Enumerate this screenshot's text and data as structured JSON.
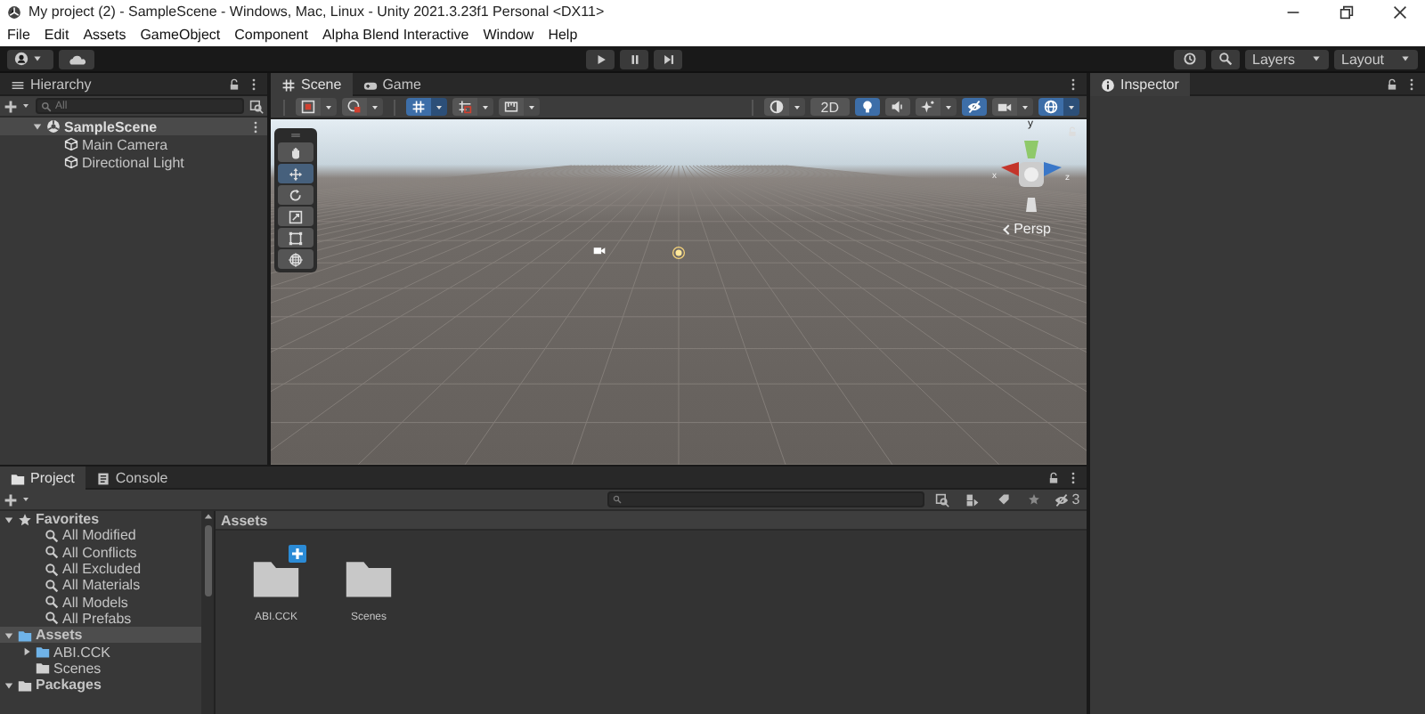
{
  "window": {
    "title": "My project (2) - SampleScene - Windows, Mac, Linux - Unity 2021.3.23f1 Personal <DX11>"
  },
  "menu": [
    "File",
    "Edit",
    "Assets",
    "GameObject",
    "Component",
    "Alpha Blend Interactive",
    "Window",
    "Help"
  ],
  "toolbar": {
    "layers": "Layers",
    "layout": "Layout"
  },
  "hierarchy": {
    "title": "Hierarchy",
    "search_placeholder": "All",
    "tree": [
      {
        "label": "SampleScene",
        "expanded": true,
        "selected": true,
        "children": [
          {
            "label": "Main Camera",
            "selected": false
          },
          {
            "label": "Directional Light",
            "selected": false
          }
        ]
      }
    ]
  },
  "scene": {
    "tabs": [
      {
        "label": "Scene",
        "selected": true
      },
      {
        "label": "Game",
        "selected": false
      }
    ],
    "left_buttons": [
      {
        "kind": "pivot",
        "on": false
      },
      {
        "kind": "global",
        "on": false
      },
      {
        "kind": "grid",
        "on": true
      },
      {
        "kind": "snap",
        "on": false
      },
      {
        "kind": "increment",
        "on": false
      }
    ],
    "right_buttons": [
      {
        "kind": "shading",
        "on": false
      },
      {
        "kind": "dimension",
        "label": "2D",
        "on": false
      },
      {
        "kind": "lighting",
        "on": true
      },
      {
        "kind": "audio",
        "on": false
      },
      {
        "kind": "effects",
        "on": false
      },
      {
        "kind": "visibility",
        "on": true
      },
      {
        "kind": "camera",
        "on": false
      },
      {
        "kind": "gizmos",
        "on": true
      }
    ],
    "tools": [
      {
        "kind": "hand",
        "selected": false
      },
      {
        "kind": "move",
        "selected": true
      },
      {
        "kind": "rotate",
        "selected": false
      },
      {
        "kind": "scale",
        "selected": false
      },
      {
        "kind": "rect",
        "selected": false
      },
      {
        "kind": "transform",
        "selected": false
      }
    ],
    "gizmo_axes": [
      "y",
      "x",
      "z"
    ],
    "projection": "Persp"
  },
  "inspector": {
    "title": "Inspector"
  },
  "project": {
    "tabs": [
      {
        "label": "Project",
        "selected": true
      },
      {
        "label": "Console",
        "selected": false
      }
    ],
    "hidden_packages": "3",
    "tree": [
      {
        "label": "Favorites",
        "kind": "favorites",
        "expanded": true,
        "selected": false,
        "children": [
          {
            "label": "All Modified",
            "kind": "search",
            "selected": false
          },
          {
            "label": "All Conflicts",
            "kind": "search",
            "selected": false
          },
          {
            "label": "All Excluded",
            "kind": "search",
            "selected": false
          },
          {
            "label": "All Materials",
            "kind": "search",
            "selected": false
          },
          {
            "label": "All Models",
            "kind": "search",
            "selected": false
          },
          {
            "label": "All Prefabs",
            "kind": "search",
            "selected": false
          }
        ]
      },
      {
        "label": "Assets",
        "kind": "badged-folder",
        "expanded": true,
        "selected": true,
        "children": [
          {
            "label": "ABI.CCK",
            "kind": "badged-folder",
            "expanded": false,
            "selected": false
          },
          {
            "label": "Scenes",
            "kind": "folder",
            "selected": false
          }
        ]
      },
      {
        "label": "Packages",
        "kind": "folder",
        "expanded": true,
        "selected": false
      }
    ],
    "breadcrumb": "Assets",
    "items": [
      {
        "label": "ABI.CCK",
        "badge": true
      },
      {
        "label": "Scenes",
        "badge": false
      }
    ]
  }
}
